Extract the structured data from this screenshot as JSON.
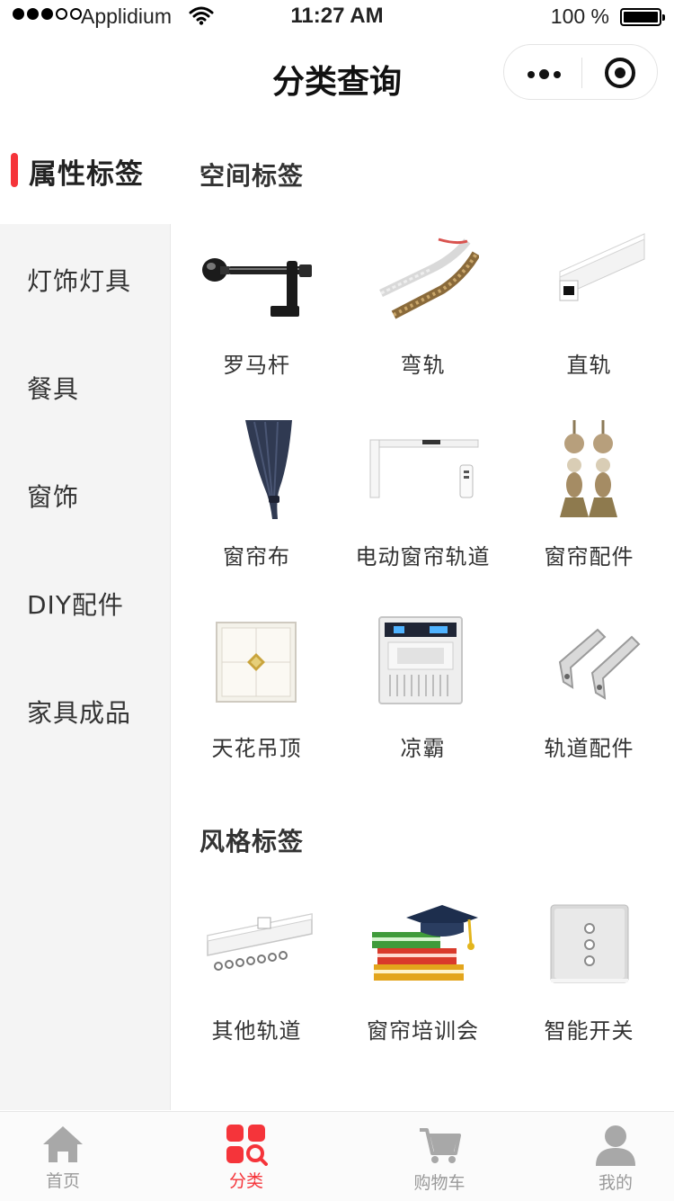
{
  "status_bar": {
    "carrier": "Applidium",
    "time": "11:27 AM",
    "battery": "100 %"
  },
  "nav": {
    "title": "分类查询"
  },
  "sidebar": {
    "header": "属性标签",
    "items": [
      {
        "label": "灯饰灯具"
      },
      {
        "label": "餐具"
      },
      {
        "label": "窗饰"
      },
      {
        "label": "DIY配件"
      },
      {
        "label": "家具成品"
      }
    ]
  },
  "sections": [
    {
      "title": "空间标签",
      "items": [
        {
          "label": "罗马杆",
          "icon": "curtain-rod-icon"
        },
        {
          "label": "弯轨",
          "icon": "curved-track-icon"
        },
        {
          "label": "直轨",
          "icon": "straight-track-icon"
        },
        {
          "label": "窗帘布",
          "icon": "curtain-fabric-icon"
        },
        {
          "label": "电动窗帘轨道",
          "icon": "electric-track-icon"
        },
        {
          "label": "窗帘配件",
          "icon": "tassel-icon"
        },
        {
          "label": "天花吊顶",
          "icon": "ceiling-panel-icon"
        },
        {
          "label": "凉霸",
          "icon": "ceiling-fan-icon"
        },
        {
          "label": "轨道配件",
          "icon": "track-bracket-icon"
        }
      ]
    },
    {
      "title": "风格标签",
      "items": [
        {
          "label": "其他轨道",
          "icon": "track-rail-icon"
        },
        {
          "label": "窗帘培训会",
          "icon": "training-books-icon"
        },
        {
          "label": "智能开关",
          "icon": "smart-switch-icon"
        }
      ]
    }
  ],
  "tabbar": {
    "active_color": "#f5343a",
    "inactive_color": "#9a9a9a",
    "items": [
      {
        "label": "首页",
        "icon": "home-icon"
      },
      {
        "label": "分类",
        "icon": "category-icon"
      },
      {
        "label": "购物车",
        "icon": "cart-icon"
      },
      {
        "label": "我的",
        "icon": "user-icon"
      }
    ]
  }
}
